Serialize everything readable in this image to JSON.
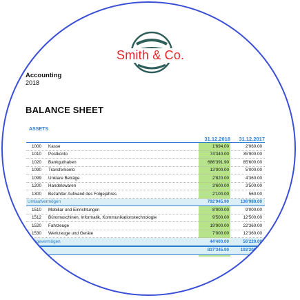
{
  "logo": {
    "name": "Smith & Co.",
    "icon": "globe-logo-icon"
  },
  "accounting": {
    "title": "Accounting",
    "year": "2018"
  },
  "sheet_title": "BALANCE SHEET",
  "section_label": "ASSETS",
  "columns": {
    "current": "31.12.2018",
    "previous": "31.12.2017"
  },
  "rows": [
    {
      "num": "1000",
      "name": "Kasse",
      "current": "1'694.00",
      "previous": "2'060.00"
    },
    {
      "num": "1010",
      "name": "Postkonto",
      "current": "74'340.00",
      "previous": "35'900.00"
    },
    {
      "num": "1020",
      "name": "Bankguthaben",
      "current": "686'391.90",
      "previous": "85'600.00"
    },
    {
      "num": "1090",
      "name": "Transferkonto",
      "current": "13'000.00",
      "previous": "5'000.00"
    },
    {
      "num": "1099",
      "name": "Unklare Beträge",
      "current": "2'820.00",
      "previous": "4'360.00"
    },
    {
      "num": "1200",
      "name": "Handelswaren",
      "current": "3'600.00",
      "previous": "3'500.00"
    },
    {
      "num": "1300",
      "name": "Bezahlter Aufwand des Folgejahres",
      "current": "2'100.00",
      "previous": "560.00"
    },
    {
      "num": "",
      "name": "Umlaufvermögen",
      "current": "792'945.90",
      "previous": "136'980.00",
      "type": "sum"
    },
    {
      "num": "1510",
      "name": "Mobiliar und Einrichtungen",
      "current": "8'000.00",
      "previous": "9'000.00"
    },
    {
      "num": "1512",
      "name": "Büromaschinen, Informatik, Kommunikationstechnologie",
      "current": "9'500.00",
      "previous": "12'500.00"
    },
    {
      "num": "1520",
      "name": "Fahrzeuge",
      "current": "19'900.00",
      "previous": "22'360.00"
    },
    {
      "num": "1530",
      "name": "Werkzeuge und Geräte",
      "current": "7'000.00",
      "previous": "12'360.00"
    },
    {
      "num": "",
      "name": "Anlagevermögen",
      "current": "44'400.00",
      "previous": "56'220.00",
      "type": "sum"
    },
    {
      "num": "",
      "name": "",
      "current": "837'345.90",
      "previous": "193'200.00",
      "type": "total"
    }
  ],
  "colors": {
    "accent": "#2a7bd0",
    "highlight": "#b7e48a",
    "brand": "#e3272d",
    "lens_ring": "#3a4fd6"
  }
}
